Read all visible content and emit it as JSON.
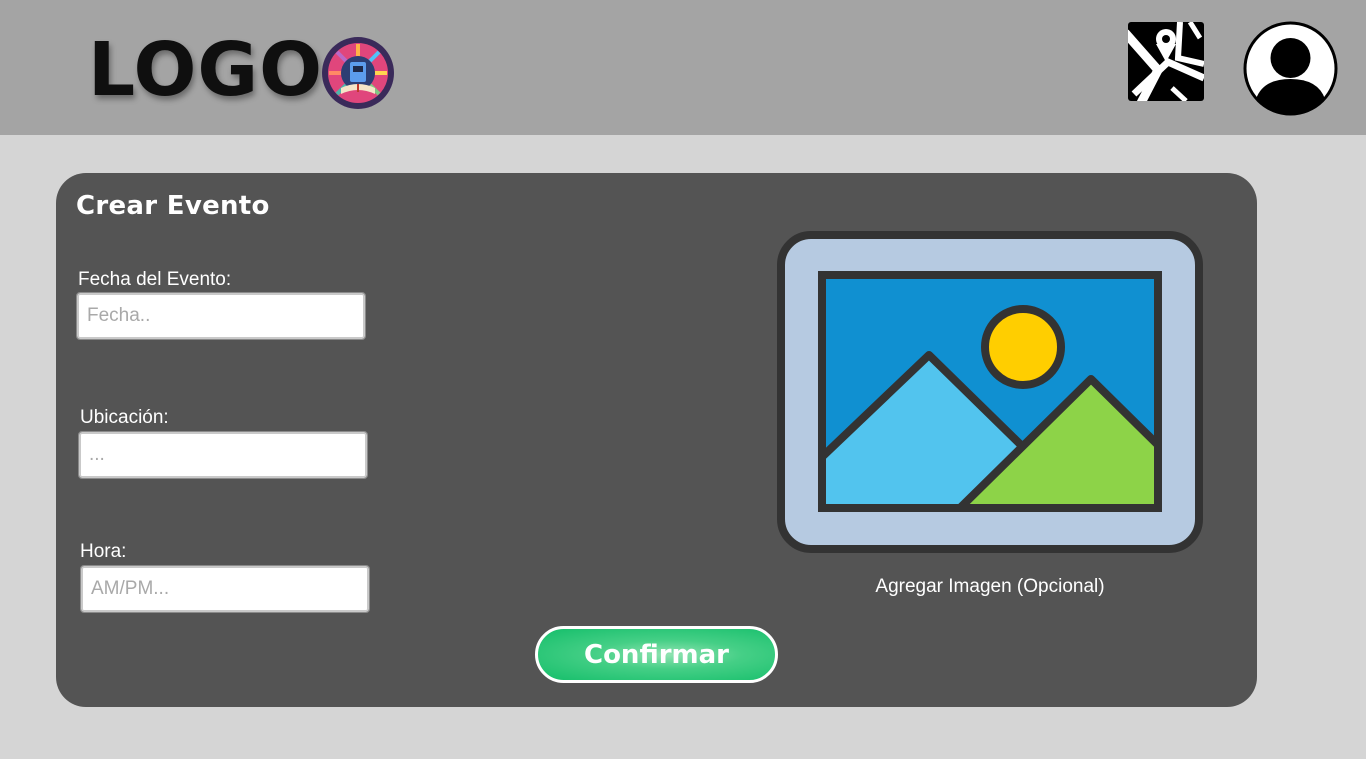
{
  "header": {
    "logo_text": "LOGO",
    "logo_badge_icon": "library-badge-icon",
    "map_icon": "map-icon",
    "avatar_icon": "user-avatar-icon"
  },
  "form": {
    "title": "Crear Evento",
    "fields": [
      {
        "label": "Fecha del Evento:",
        "placeholder": "Fecha..",
        "value": ""
      },
      {
        "label": "Ubicación:",
        "placeholder": "...",
        "value": ""
      },
      {
        "label": "Hora:",
        "placeholder": "AM/PM...",
        "value": ""
      }
    ],
    "image_picker": {
      "icon": "image-placeholder-icon",
      "caption": "Agregar Imagen (Opcional)"
    },
    "confirm_label": "Confirmar"
  },
  "colors": {
    "header_bg": "#a4a4a4",
    "page_bg": "#d5d5d5",
    "card_bg": "#545454",
    "confirm_green": "#14be6a"
  }
}
